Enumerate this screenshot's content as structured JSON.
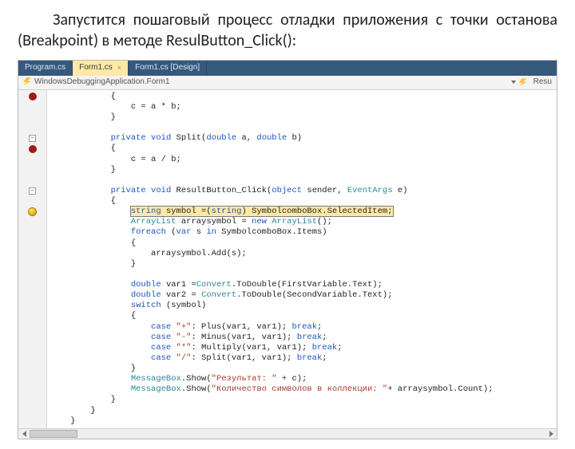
{
  "intro": "Запустится пошаговый процесс отладки приложения с точки останова (Breakpoint) в методе ResulButton_Click():",
  "tabs": {
    "program": "Program.cs",
    "form1": "Form1.cs",
    "design": "Form1.cs [Design]"
  },
  "pathbar": {
    "left": "WindowsDebuggingApplication.Form1",
    "right": "Resu"
  },
  "code": {
    "l01": "            {",
    "l02": "                c = a * b;",
    "l03": "            }",
    "l04": "",
    "l05a": "            ",
    "l05kw1": "private",
    "l05kw2": " void",
    "l05name": " Split(",
    "l05kw3": "double",
    "l05mid": " a, ",
    "l05kw4": "double",
    "l05end": " b)",
    "l06": "            {",
    "l07": "                c = a / b;",
    "l08": "            }",
    "l09": "",
    "l10a": "            ",
    "l10kw1": "private",
    "l10kw2": " void",
    "l10name": " ResultButton_Click(",
    "l10kw3": "object",
    "l10mid": " sender, ",
    "l10type": "EventArgs",
    "l10end": " e)",
    "l11": "            {",
    "l12a": "                ",
    "l12kw": "string",
    "l12mid": " symbol =(",
    "l12kw2": "string",
    "l12end": ") SymbolcomboBox.SelectedItem;",
    "l13a": "                ",
    "l13t": "ArrayList",
    "l13mid": " arraysymbol = ",
    "l13kw": "new",
    "l13sp": " ",
    "l13t2": "ArrayList",
    "l13end": "();",
    "l14a": "                ",
    "l14kw": "foreach",
    "l14mid": " (",
    "l14kw2": "var",
    "l14mid2": " s ",
    "l14kw3": "in",
    "l14end": " SymbolcomboBox.Items)",
    "l15": "                {",
    "l16": "                    arraysymbol.Add(s);",
    "l17": "                }",
    "l18": "",
    "l19a": "                ",
    "l19kw": "double",
    "l19mid": " var1 =",
    "l19t": "Convert",
    "l19end": ".ToDouble(FirstVariable.Text);",
    "l20a": "                ",
    "l20kw": "double",
    "l20mid": " var2 = ",
    "l20t": "Convert",
    "l20end": ".ToDouble(SecondVariable.Text);",
    "l21a": "                ",
    "l21kw": "switch",
    "l21end": " (symbol)",
    "l22": "                {",
    "l23a": "                    ",
    "l23kw": "case ",
    "l23s": "\"+\"",
    "l23mid": ": Plus(var1, var1); ",
    "l23kw2": "break",
    "l23end": ";",
    "l24a": "                    ",
    "l24kw": "case ",
    "l24s": "\"-\"",
    "l24mid": ": Minus(var1, var1); ",
    "l24kw2": "break",
    "l24end": ";",
    "l25a": "                    ",
    "l25kw": "case ",
    "l25s": "\"*\"",
    "l25mid": ": Multiply(var1, var1); ",
    "l25kw2": "break",
    "l25end": ";",
    "l26a": "                    ",
    "l26kw": "case ",
    "l26s": "\"/\"",
    "l26mid": ": Split(var1, var1); ",
    "l26kw2": "break",
    "l26end": ";",
    "l27": "                }",
    "l28a": "                ",
    "l28t": "MessageBox",
    "l28mid": ".Show(",
    "l28s": "\"Результат: \"",
    "l28end": " + c);",
    "l29a": "                ",
    "l29t": "MessageBox",
    "l29mid": ".Show(",
    "l29s": "\"Количество символов в коллекции: \"",
    "l29end": "+ arraysymbol.Count);",
    "l30": "            }",
    "l31": "        }",
    "l32": "    }"
  }
}
